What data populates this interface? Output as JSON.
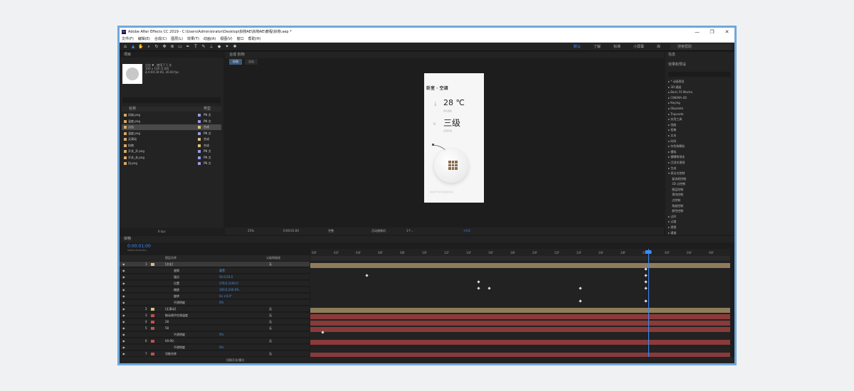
{
  "window": {
    "title": "Adobe After Effects CC 2019 - C:\\Users\\Administrator\\Desktop\\拟物AE\\拟物AE\\教程\\拟物.aep *",
    "controls": [
      "—",
      "❐",
      "✕"
    ]
  },
  "menu": [
    "文件(F)",
    "编辑(E)",
    "合成(C)",
    "图层(L)",
    "效果(T)",
    "动画(A)",
    "视图(V)",
    "窗口",
    "帮助(H)"
  ],
  "workspaces": {
    "items": [
      "默认",
      "了解",
      "标准",
      "小屏幕",
      "库"
    ],
    "current": "默认",
    "search_help": "搜索帮助"
  },
  "project": {
    "title": "项目",
    "selected_name": "点击 ▼ , 使用了 1 次",
    "selected_size": "100 x 100 (1.00)",
    "selected_duration": "Δ 0:00:30:00, 30.00 fps",
    "col_name": "名称",
    "col_type": "类型",
    "items": [
      {
        "name": "风扇.png",
        "type": "PN 文",
        "color": "#9a9ae0"
      },
      {
        "name": "温度.png",
        "type": "PN 文",
        "color": "#9a9ae0"
      },
      {
        "name": "点击",
        "type": "合成",
        "color": "#d8c07a",
        "selected": true
      },
      {
        "name": "温度.png",
        "type": "PN 文",
        "color": "#9a9ae0"
      },
      {
        "name": "无滑动",
        "type": "合成",
        "color": "#d8c07a"
      },
      {
        "name": "拟物",
        "type": "合成",
        "color": "#d8c07a"
      },
      {
        "name": "开关_开.png",
        "type": "PN 文",
        "color": "#9a9ae0"
      },
      {
        "name": "开关_关.png",
        "type": "PN 文",
        "color": "#9a9ae0"
      },
      {
        "name": "风.png",
        "type": "PN 文",
        "color": "#9a9ae0"
      }
    ],
    "footer_bpc": "8 bpc"
  },
  "composition": {
    "tab": "合成 拟物",
    "subtabs": [
      "拟物",
      "点击"
    ],
    "current_subtab": "拟物",
    "zoom": "25%",
    "timecode": "0:00:01:00",
    "resolution": "完整",
    "camera": "活动摄像机",
    "views": "1个...",
    "exposure": "+0.0"
  },
  "phone": {
    "title": "卧室 · 空调",
    "temperature": "28 ℃",
    "temperature_label": "室内温度",
    "fan": "三级",
    "fan_label": "空调风速",
    "footer": "拖动调节空调温度和风速"
  },
  "effects": {
    "title": "效果和预设",
    "header": "信息",
    "items": [
      "▸ * 动画预设",
      "▸ 3D 通道",
      "▸ Boris FX Mocha",
      "▸ CINEMA 4D",
      "▸ Keying",
      "▸ Obsolete",
      "▸ Trapcode",
      "▸ 实用工具",
      "▸ 扭曲",
      "▸ 抠像",
      "▸ 文本",
      "▸ 时间",
      "▸ 杂色和颗粒",
      "▸ 模拟",
      "▸ 模糊和锐化",
      "▸ 沉浸式视频",
      "▸ 生成",
      "▾ 表达式控制",
      "    复选框控制",
      "    3D 点控制",
      "    图层控制",
      "    滑块控制",
      "    点控制",
      "    角度控制",
      "    颜色控制",
      "▸ 过时",
      "▸ 过渡",
      "▸ 透视",
      "▸ 通道"
    ]
  },
  "timeline": {
    "tab": "拟物",
    "timecode": "0:00:01:00",
    "sub": "00030 (30.00 fps)",
    "col_name": "图层名称",
    "col_mode": "父级和链接",
    "layers": [
      {
        "num": "1",
        "name": "[点击]",
        "parent": "无",
        "color": "#d8c07a",
        "selected": true
      },
      {
        "num": "",
        "name": "变换",
        "parent": "重置"
      },
      {
        "num": "",
        "name": "锚点",
        "parent": "50.0,50.0"
      },
      {
        "num": "",
        "name": "位置",
        "parent": "378.0,1160.0"
      },
      {
        "num": "",
        "name": "缩放",
        "parent": "100.0,100.0%"
      },
      {
        "num": "",
        "name": "旋转",
        "parent": "0x +0.0°"
      },
      {
        "num": "",
        "name": "不透明度",
        "parent": "0%"
      },
      {
        "num": "2",
        "name": "[无滑动]",
        "parent": "无",
        "color": "#d8c07a"
      },
      {
        "num": "3",
        "name": "拖动调节空调温度",
        "parent": "无",
        "color": "#c0504d"
      },
      {
        "num": "4",
        "name": "28",
        "parent": "无",
        "color": "#c0504d"
      },
      {
        "num": "5",
        "name": "58",
        "parent": "无",
        "color": "#c0504d"
      },
      {
        "num": "",
        "name": "不透明度",
        "parent": "0%"
      },
      {
        "num": "6",
        "name": "00:00;",
        "parent": "无",
        "color": "#c0504d"
      },
      {
        "num": "",
        "name": "不透明度",
        "parent": "0%"
      },
      {
        "num": "7",
        "name": "功能名称",
        "parent": "无",
        "color": "#c0504d"
      }
    ],
    "ruler": [
      "00f",
      "02f",
      "04f",
      "06f",
      "08f",
      "10f",
      "12f",
      "14f",
      "16f",
      "18f",
      "20f",
      "22f",
      "24f",
      "26f",
      "28f",
      "01:00f",
      "02f",
      "04f",
      "06f"
    ],
    "footer": "切换开关/模式"
  }
}
